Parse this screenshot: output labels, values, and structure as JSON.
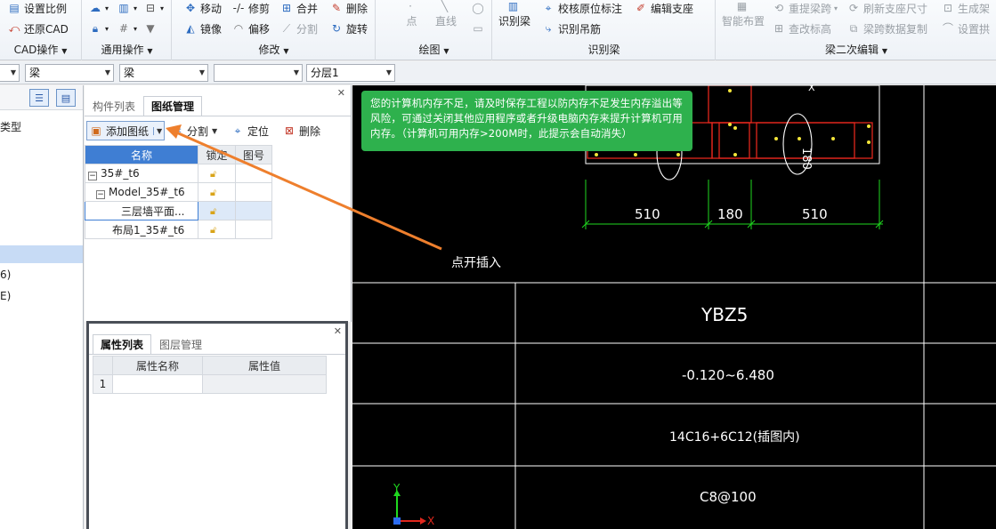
{
  "ribbon": {
    "cad_ops": {
      "title": "CAD操作",
      "set_scale": "设置比例",
      "restore_cad": "还原CAD"
    },
    "general_ops": {
      "title": "通用操作"
    },
    "modify": {
      "title": "修改",
      "move": "移动",
      "trim": "修剪",
      "merge": "合并",
      "delete": "删除",
      "mirror": "镜像",
      "offset": "偏移",
      "split": "分割",
      "rotate": "旋转"
    },
    "draw": {
      "title": "绘图",
      "point": "点",
      "line": "直线"
    },
    "identify_beam": {
      "title": "识别梁",
      "identify_beam_btn": "识别梁",
      "verify_original": "校核原位标注",
      "identify_hanger": "识别吊筋",
      "edit_support": "编辑支座"
    },
    "beam_secondary": {
      "title": "梁二次编辑",
      "smart_layout": "智能布置",
      "reextract_span": "重提梁跨",
      "check_elevation": "查改标高",
      "refresh_support": "刷新支座尺寸",
      "copy_beam_data": "梁跨数据复制",
      "generate": "生成架",
      "set_arch": "设置拱"
    }
  },
  "combos": {
    "c1": "",
    "c2": "梁",
    "c3": "梁",
    "c4": "",
    "c5": "分层1"
  },
  "left_panel": {
    "items": [
      "类型",
      "6)",
      "E)"
    ]
  },
  "drawing_panel": {
    "tabs": [
      "构件列表",
      "图纸管理"
    ],
    "tools": {
      "add_drawing": "添加图纸",
      "split": "分割",
      "locate": "定位",
      "delete": "删除"
    },
    "columns": [
      "名称",
      "锁定",
      "图号"
    ],
    "rows": [
      {
        "name": "35#_t6",
        "locked": true,
        "number": ""
      },
      {
        "name": "Model_35#_t6",
        "locked": true,
        "number": ""
      },
      {
        "name": "三层墙平面...",
        "locked": true,
        "number": ""
      },
      {
        "name": "布局1_35#_t6",
        "locked": true,
        "number": ""
      }
    ]
  },
  "property_panel": {
    "tabs": [
      "属性列表",
      "图层管理"
    ],
    "columns": [
      "属性名称",
      "属性值"
    ],
    "rows": [
      {
        "index": "1",
        "name": "",
        "value": ""
      }
    ]
  },
  "canvas": {
    "dim_left": "510",
    "dim_mid": "180",
    "dim_right": "510",
    "table_name": "YBZ5",
    "table_elevation": "-0.120~6.480",
    "table_rebar": "14C16+6C12(插图内)",
    "table_stirrup": "C8@100",
    "axis_x": "X",
    "axis_y": "Y",
    "vertical_tag": "180"
  },
  "notification": {
    "text": "您的计算机内存不足，请及时保存工程以防内存不足发生内存溢出等风险，可通过关闭其他应用程序或者升级电脑内存来提升计算机可用内存。（计算机可用内存>200M时，此提示会自动消失）"
  },
  "callout": {
    "text": "点开插入"
  },
  "colors": {
    "accent_blue": "#3f7ed3",
    "toast_green": "#2eb14d",
    "arrow_orange": "#ee7f2d",
    "cad_green": "#1fd81f",
    "cad_red": "#e0271d"
  }
}
